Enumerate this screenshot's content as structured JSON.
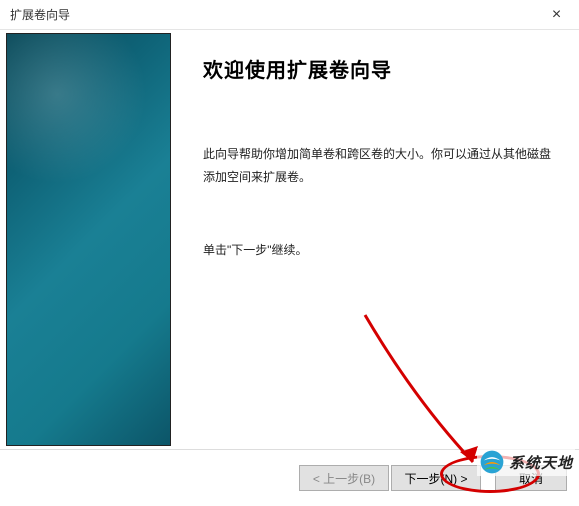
{
  "titlebar": {
    "title": "扩展卷向导",
    "close_label": "×"
  },
  "wizard": {
    "heading": "欢迎使用扩展卷向导",
    "paragraph1": "此向导帮助你增加简单卷和跨区卷的大小。你可以通过从其他磁盘添加空间来扩展卷。",
    "paragraph2": "单击\"下一步\"继续。"
  },
  "buttons": {
    "back": "< 上一步(B)",
    "next": "下一步(N) >",
    "cancel": "取消"
  },
  "watermark": {
    "text": "系统天地"
  },
  "colors": {
    "sidebar_gradient_start": "#0a4a5a",
    "sidebar_gradient_end": "#0c5568",
    "annotation": "#d40000"
  }
}
